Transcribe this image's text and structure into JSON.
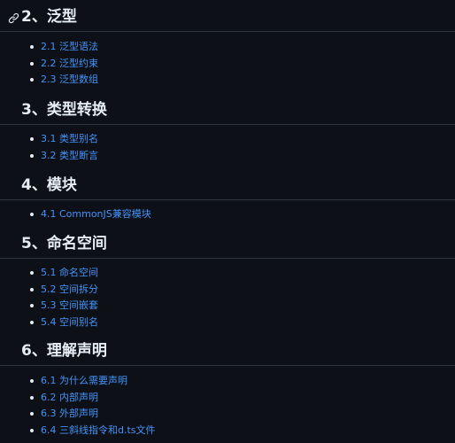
{
  "sections": [
    {
      "title": "2、泛型",
      "items": [
        "2.1 泛型语法",
        "2.2 泛型约束",
        "2.3 泛型数组"
      ]
    },
    {
      "title": "3、类型转换",
      "items": [
        "3.1 类型别名",
        "3.2 类型断言"
      ]
    },
    {
      "title": "4、模块",
      "items": [
        "4.1 CommonJS兼容模块"
      ]
    },
    {
      "title": "5、命名空间",
      "items": [
        "5.1 命名空间",
        "5.2 空间拆分",
        "5.3 空间嵌套",
        "5.4 空间别名"
      ]
    },
    {
      "title": "6、理解声明",
      "items": [
        "6.1 为什么需要声明",
        "6.2 内部声明",
        "6.3 外部声明",
        "6.4 三斜线指令和d.ts文件"
      ]
    }
  ],
  "colors": {
    "background": "#0d1117",
    "text": "#e6edf3",
    "link": "#4493f8",
    "divider": "#30363d"
  },
  "icons": {
    "anchor": "link-icon"
  }
}
